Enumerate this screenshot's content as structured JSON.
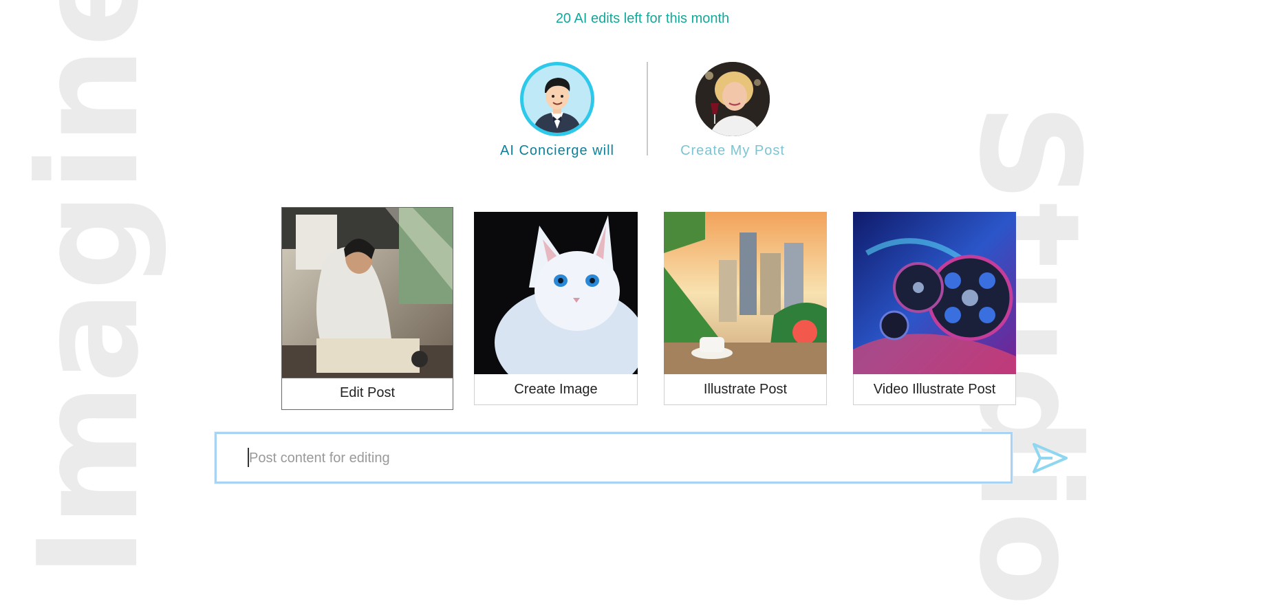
{
  "background_words": {
    "left": "Imagine",
    "right": "Studio"
  },
  "quota_text": "20 AI edits left for this month",
  "modes": {
    "ai": {
      "label": "AI Concierge will",
      "avatar": "concierge-avatar"
    },
    "my": {
      "label": "Create My Post",
      "avatar": "woman-with-wine-avatar"
    }
  },
  "cards": [
    {
      "label": "Edit Post",
      "image": "artist-painting-image",
      "selected": true
    },
    {
      "label": "Create Image",
      "image": "white-cat-image",
      "selected": false
    },
    {
      "label": "Illustrate Post",
      "image": "city-garden-coffee-image",
      "selected": false
    },
    {
      "label": "Video Illustrate Post",
      "image": "film-reels-image",
      "selected": false
    }
  ],
  "composer": {
    "placeholder": "Post content for editing",
    "value": ""
  },
  "send_icon": "send-icon",
  "colors": {
    "accent": "#12a89a",
    "avatar_ring": "#2ec9ea",
    "input_border": "#a9d3f2",
    "send": "#8fd6f0"
  }
}
